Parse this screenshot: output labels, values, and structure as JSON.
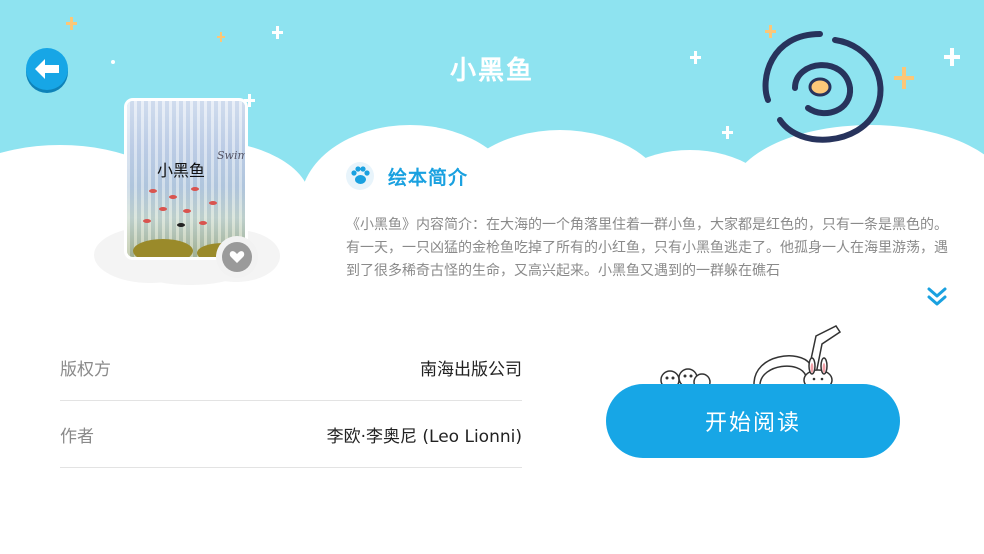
{
  "header": {
    "title": "小黑鱼",
    "back_label": "返回"
  },
  "book": {
    "cover_title": "小黑鱼",
    "cover_subtitle": "Swim",
    "favorite_icon": "heart-icon"
  },
  "intro": {
    "heading": "绘本简介",
    "text": "《小黑鱼》内容简介：在大海的一个角落里住着一群小鱼，大家都是红色的，只有一条是黑色的。有一天，一只凶猛的金枪鱼吃掉了所有的小红鱼，只有小黑鱼逃走了。他孤身一人在海里游荡，遇到了很多稀奇古怪的生命，又高兴起来。小黑鱼又遇到的一群躲在礁石",
    "expand_icon": "double-chevron-down-icon"
  },
  "details": [
    {
      "key": "版权方",
      "value": "南海出版公司"
    },
    {
      "key": "作者",
      "value": "李欧·李奥尼 (Leo Lionni)"
    }
  ],
  "actions": {
    "read_label": "开始阅读"
  },
  "colors": {
    "sky": "#8ee3f0",
    "accent": "#17a6e6",
    "spiral": "#27335c",
    "star": "#fbc778"
  }
}
